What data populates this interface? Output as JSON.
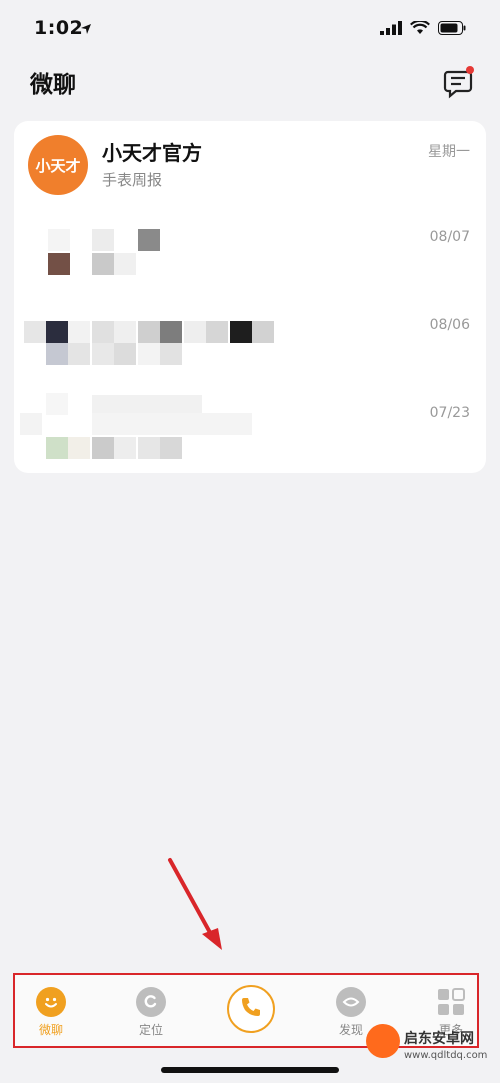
{
  "status_bar": {
    "time": "1:02"
  },
  "header": {
    "title": "微聊"
  },
  "chats": [
    {
      "name": "小天才官方",
      "subtitle": "手表周报",
      "time": "星期一",
      "avatar_text": "小天才"
    },
    {
      "name": "",
      "subtitle": "",
      "time": "08/07"
    },
    {
      "name": "",
      "subtitle": "",
      "time": "08/06"
    },
    {
      "name": "",
      "subtitle": "",
      "time": "07/23"
    }
  ],
  "tabbar": {
    "items": [
      {
        "label": "微聊",
        "icon": "smile-icon",
        "active": true
      },
      {
        "label": "定位",
        "icon": "location-icon",
        "active": false
      },
      {
        "label": "",
        "icon": "phone-icon",
        "active": false
      },
      {
        "label": "发现",
        "icon": "discover-icon",
        "active": false
      },
      {
        "label": "更多",
        "icon": "grid-icon",
        "active": false
      }
    ]
  },
  "watermark": {
    "title": "启东安卓网",
    "url": "www.qdltdq.com"
  },
  "colors": {
    "accent": "#f0a020",
    "annotation": "#d9262a",
    "brand": "#f07f2c"
  }
}
